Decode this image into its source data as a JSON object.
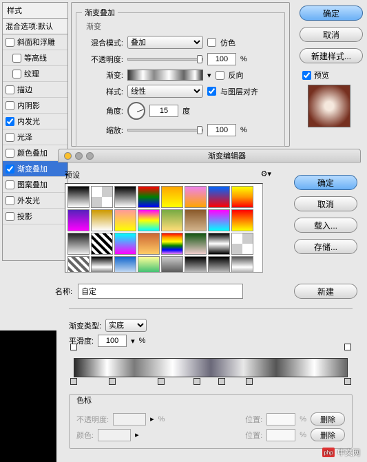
{
  "left": {
    "header": "样式",
    "sub": "混合选项:默认",
    "items": [
      {
        "label": "斜面和浮雕"
      },
      {
        "label": "等高线",
        "indent": true
      },
      {
        "label": "纹理",
        "indent": true
      },
      {
        "label": "描边"
      },
      {
        "label": "内阴影"
      },
      {
        "label": "内发光",
        "checked": true
      },
      {
        "label": "光泽"
      },
      {
        "label": "颜色叠加"
      },
      {
        "label": "渐变叠加",
        "checked": true,
        "selected": true
      },
      {
        "label": "图案叠加"
      },
      {
        "label": "外发光"
      },
      {
        "label": "投影"
      }
    ]
  },
  "main": {
    "legend": "渐变叠加",
    "sub": "渐变",
    "blend_label": "混合模式:",
    "blend_value": "叠加",
    "dither": "仿色",
    "opacity_label": "不透明度:",
    "opacity_value": "100",
    "pct": "%",
    "gradient_label": "渐变:",
    "reverse": "反向",
    "style_label": "样式:",
    "style_value": "线性",
    "align": "与图层对齐",
    "angle_label": "角度:",
    "angle_value": "15",
    "deg": "度",
    "scale_label": "缩放:",
    "scale_value": "100"
  },
  "right": {
    "ok": "确定",
    "cancel": "取消",
    "newstyle": "新建样式...",
    "preview": "预览"
  },
  "editor": {
    "title": "渐变编辑器"
  },
  "presets": {
    "label": "预设"
  },
  "ed_btns": {
    "ok": "确定",
    "cancel": "取消",
    "load": "载入...",
    "save": "存储..."
  },
  "name_label": "名称:",
  "name_value": "自定",
  "new_label": "新建",
  "gtype": {
    "label": "渐变类型:",
    "value": "实底",
    "smooth_label": "平滑度:",
    "smooth_value": "100",
    "pct": "%"
  },
  "stops": {
    "legend": "色标",
    "op_label": "不透明度:",
    "pct": "%",
    "pos_label": "位置:",
    "del": "删除",
    "color_label": "颜色:"
  },
  "watermark": "中文网",
  "wm_prefix": "php"
}
